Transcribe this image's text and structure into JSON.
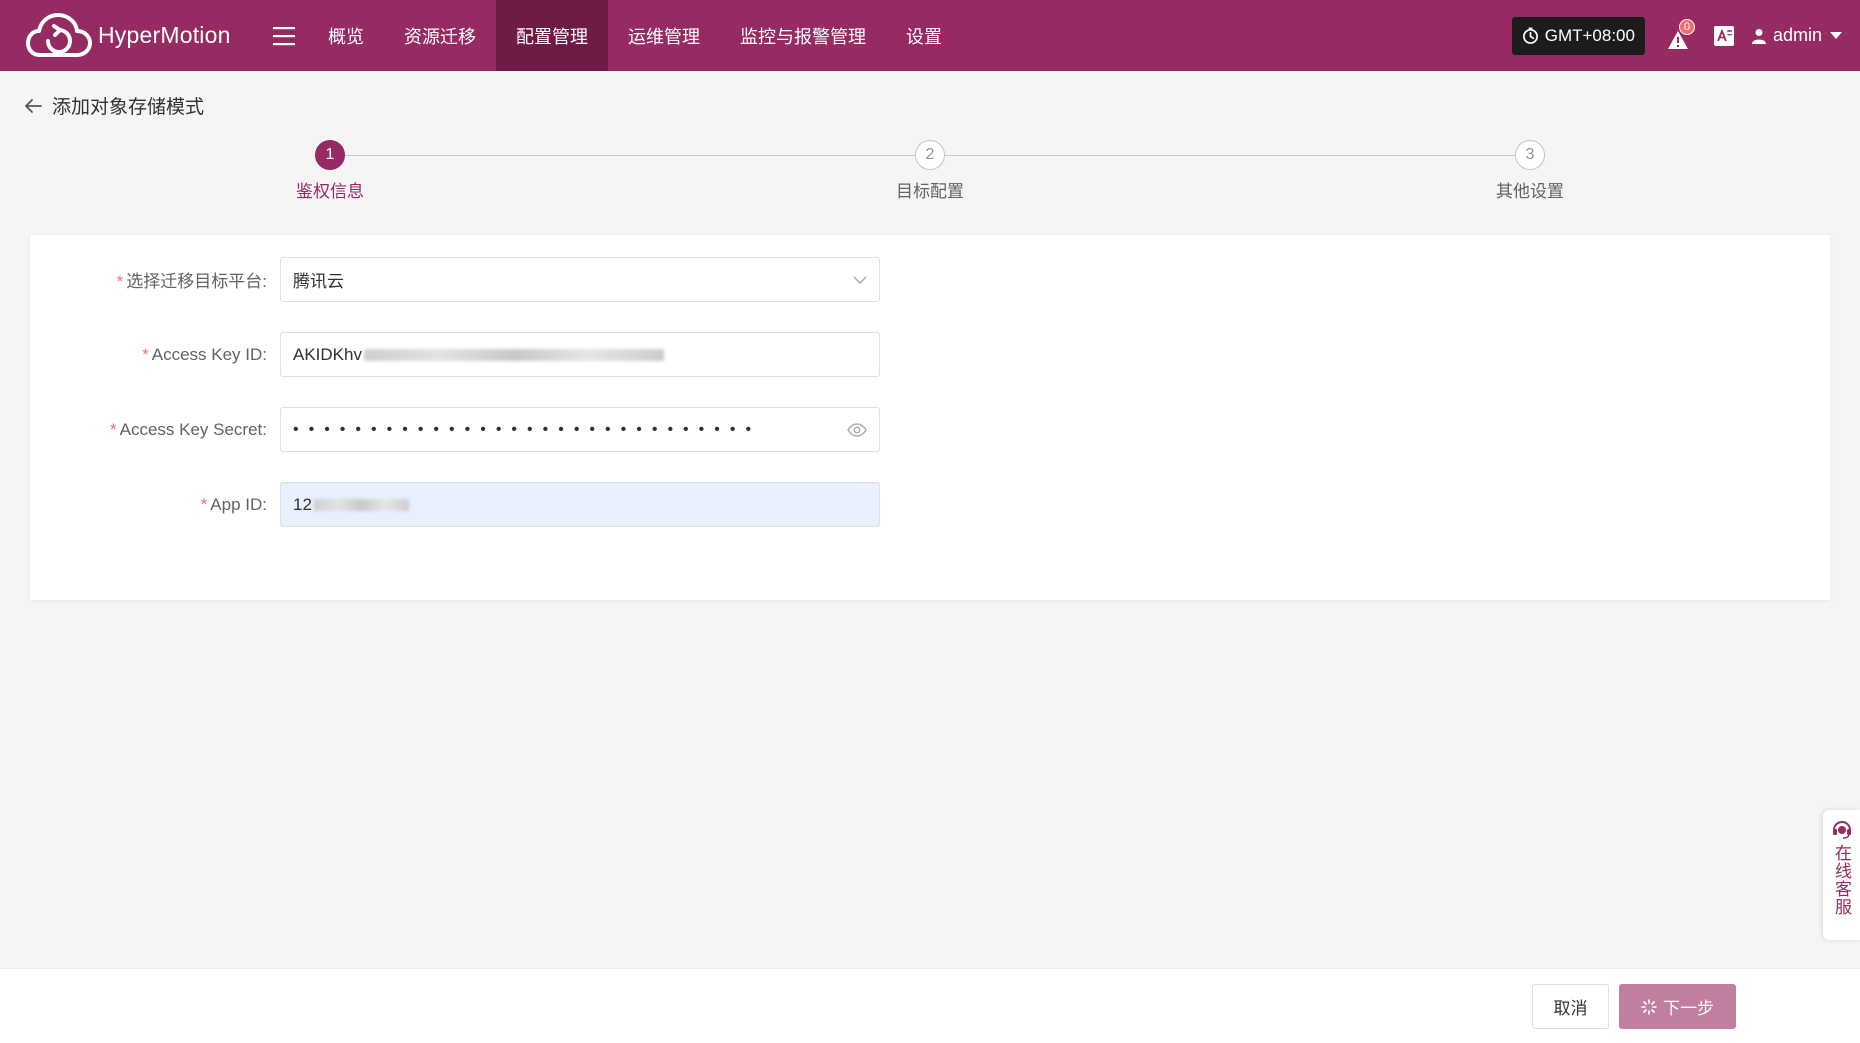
{
  "app": {
    "name": "HyperMotion"
  },
  "nav": [
    {
      "label": "概览",
      "active": false
    },
    {
      "label": "资源迁移",
      "active": false
    },
    {
      "label": "配置管理",
      "active": true
    },
    {
      "label": "运维管理",
      "active": false
    },
    {
      "label": "监控与报警管理",
      "active": false
    },
    {
      "label": "设置",
      "active": false
    }
  ],
  "header": {
    "timezone": "GMT+08:00",
    "alert_count": "0",
    "user": "admin"
  },
  "page": {
    "title": "添加对象存储模式"
  },
  "steps": [
    {
      "num": "1",
      "label": "鉴权信息",
      "active": true
    },
    {
      "num": "2",
      "label": "目标配置",
      "active": false
    },
    {
      "num": "3",
      "label": "其他设置",
      "active": false
    }
  ],
  "form": {
    "platform": {
      "label": "选择迁移目标平台:",
      "value": "腾讯云"
    },
    "access_key_id": {
      "label": "Access Key ID:",
      "value_visible": "AKIDKhv"
    },
    "access_key_secret": {
      "label": "Access Key Secret:",
      "masked": "••••••••••••••••••••••••••••••"
    },
    "app_id": {
      "label": "App ID:",
      "value_visible": "12"
    }
  },
  "footer": {
    "cancel": "取消",
    "next": "下一步"
  },
  "service": {
    "label": "在线客服"
  },
  "colors": {
    "primary": "#952b62",
    "primary_dark": "#6e1c45",
    "next_button": "#c07fa0",
    "required": "#f56c6c"
  }
}
